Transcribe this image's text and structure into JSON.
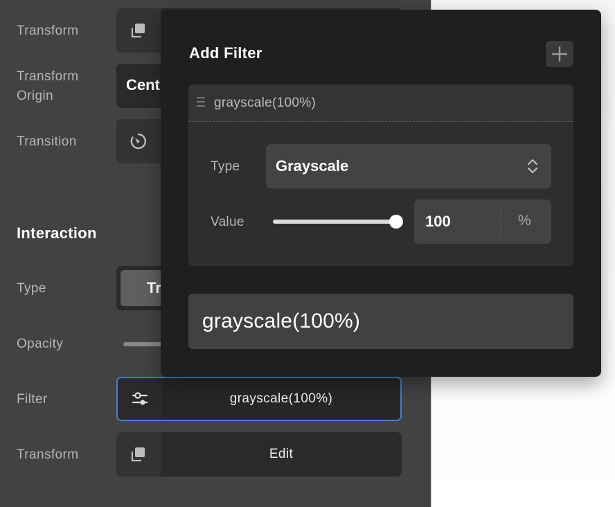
{
  "panel": {
    "rows": {
      "transform_top": "Transform",
      "transform_origin": "Transform Origin",
      "transform_origin_line1": "Transform",
      "transform_origin_line2": "Origin",
      "transform_origin_value": "Cent",
      "transition": "Transition"
    },
    "interaction": {
      "title": "Interaction",
      "type_label": "Type",
      "type_value": "Tr",
      "opacity_label": "Opacity",
      "filter_label": "Filter",
      "filter_value": "grayscale(100%)",
      "transform_label": "Transform",
      "transform_value": "Edit"
    }
  },
  "popup": {
    "title": "Add Filter",
    "add_icon": "plus-icon",
    "filter_item": {
      "summary": "grayscale(100%)",
      "type_label": "Type",
      "type_value": "Grayscale",
      "value_label": "Value",
      "value": "100",
      "unit": "%",
      "slider_fraction": 1.0
    },
    "result": "grayscale(100%)"
  },
  "colors": {
    "panel_bg": "#424242",
    "popup_bg": "#1f1f1f",
    "focus_border": "#3f7fc7"
  }
}
